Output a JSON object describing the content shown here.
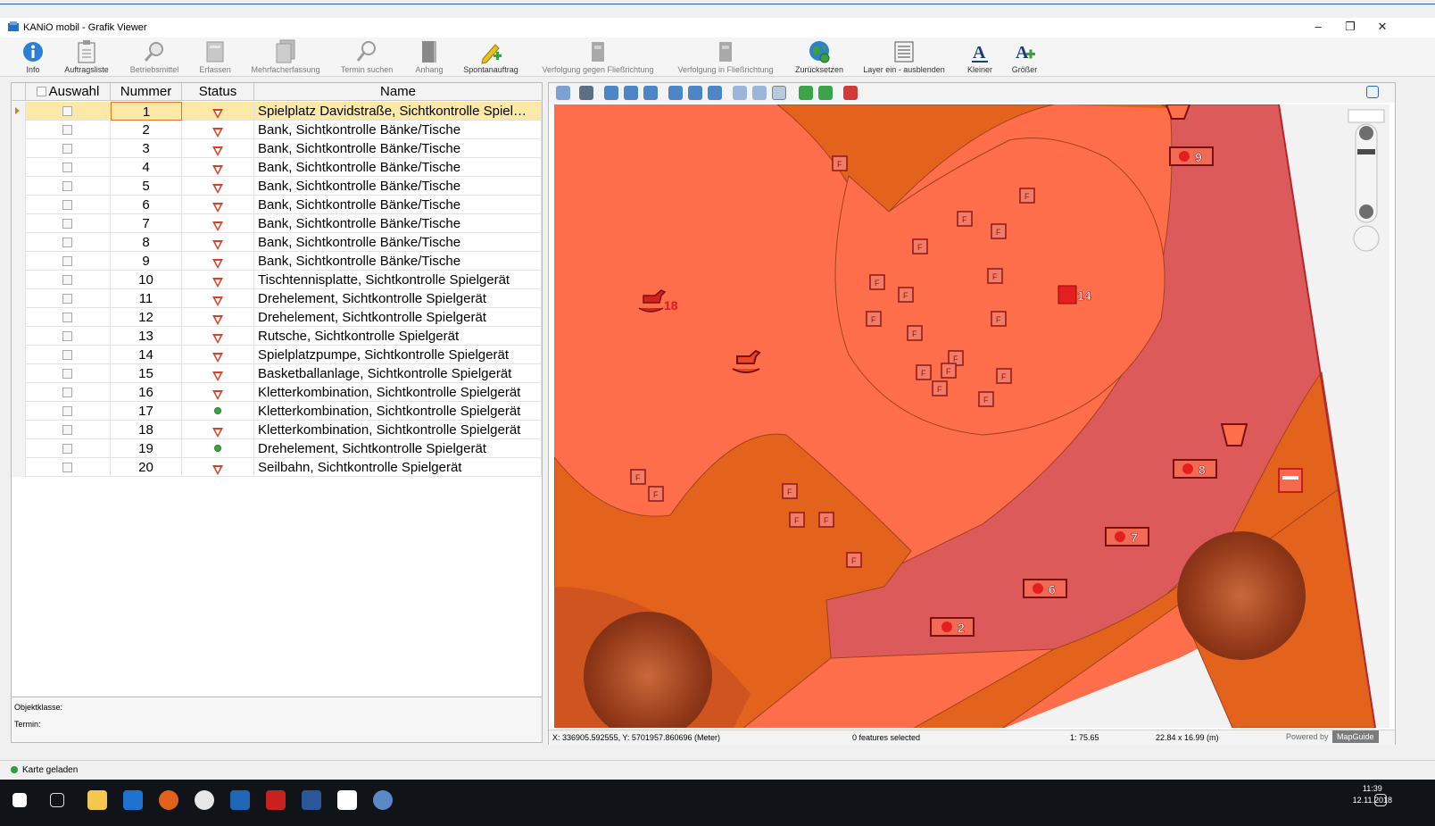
{
  "window": {
    "title": "KANiO mobil - Grafik Viewer",
    "minimize": "–",
    "restore": "❐",
    "close": "✕"
  },
  "toolbar": [
    {
      "label": "Info",
      "icon": "info-icon",
      "enabled": true
    },
    {
      "label": "Auftragsliste",
      "icon": "clipboard-icon",
      "enabled": true
    },
    {
      "label": "Betriebsmittel",
      "icon": "magnifier-icon",
      "enabled": false
    },
    {
      "label": "Erfassen",
      "icon": "form-icon",
      "enabled": false
    },
    {
      "label": "Mehrfacherfassung",
      "icon": "multi-form-icon",
      "enabled": false
    },
    {
      "label": "Termin suchen",
      "icon": "search-icon",
      "enabled": false
    },
    {
      "label": "Anhang",
      "icon": "book-icon",
      "enabled": false
    },
    {
      "label": "Spontanauftrag",
      "icon": "pencil-plus-icon",
      "enabled": true
    },
    {
      "label": "Verfolgung gegen Fließrichtung",
      "icon": "trace-upstream-icon",
      "enabled": false
    },
    {
      "label": "Verfolgung in Fließrichtung",
      "icon": "trace-downstream-icon",
      "enabled": false
    },
    {
      "label": "Zurücksetzen",
      "icon": "globe-icon",
      "enabled": true
    },
    {
      "label": "Layer ein - ausblenden",
      "icon": "layers-icon",
      "enabled": true
    },
    {
      "label": "Kleiner",
      "icon": "font-smaller-icon",
      "enabled": true
    },
    {
      "label": "Größer",
      "icon": "font-larger-icon",
      "enabled": true
    }
  ],
  "grid": {
    "headers": {
      "select": "Auswahl",
      "number": "Nummer",
      "status": "Status",
      "name": "Name"
    },
    "rows": [
      {
        "number": "1",
        "status": "open",
        "name": "Spielplatz Davidstraße, Sichtkontrolle Spiel…"
      },
      {
        "number": "2",
        "status": "open",
        "name": "Bank, Sichtkontrolle Bänke/Tische"
      },
      {
        "number": "3",
        "status": "open",
        "name": "Bank, Sichtkontrolle Bänke/Tische"
      },
      {
        "number": "4",
        "status": "open",
        "name": "Bank, Sichtkontrolle Bänke/Tische"
      },
      {
        "number": "5",
        "status": "open",
        "name": "Bank, Sichtkontrolle Bänke/Tische"
      },
      {
        "number": "6",
        "status": "open",
        "name": "Bank, Sichtkontrolle Bänke/Tische"
      },
      {
        "number": "7",
        "status": "open",
        "name": "Bank, Sichtkontrolle Bänke/Tische"
      },
      {
        "number": "8",
        "status": "open",
        "name": "Bank, Sichtkontrolle Bänke/Tische"
      },
      {
        "number": "9",
        "status": "open",
        "name": "Bank, Sichtkontrolle Bänke/Tische"
      },
      {
        "number": "10",
        "status": "open",
        "name": "Tischtennisplatte, Sichtkontrolle Spielgerät"
      },
      {
        "number": "11",
        "status": "open",
        "name": "Drehelement, Sichtkontrolle Spielgerät"
      },
      {
        "number": "12",
        "status": "open",
        "name": "Drehelement, Sichtkontrolle Spielgerät"
      },
      {
        "number": "13",
        "status": "open",
        "name": "Rutsche, Sichtkontrolle Spielgerät"
      },
      {
        "number": "14",
        "status": "open",
        "name": "Spielplatzpumpe, Sichtkontrolle Spielgerät"
      },
      {
        "number": "15",
        "status": "open",
        "name": "Basketballanlage, Sichtkontrolle Spielgerät"
      },
      {
        "number": "16",
        "status": "open",
        "name": "Kletterkombination, Sichtkontrolle Spielgerät"
      },
      {
        "number": "17",
        "status": "done",
        "name": "Kletterkombination, Sichtkontrolle Spielgerät"
      },
      {
        "number": "18",
        "status": "open",
        "name": "Kletterkombination, Sichtkontrolle Spielgerät"
      },
      {
        "number": "19",
        "status": "done",
        "name": "Drehelement, Sichtkontrolle Spielgerät"
      },
      {
        "number": "20",
        "status": "open",
        "name": "Seilbahn, Sichtkontrolle Spielgerät"
      }
    ]
  },
  "details": {
    "objektklasse": "Objektklasse:",
    "termin": "Termin:"
  },
  "map": {
    "labels": [
      "18",
      "14",
      "9",
      "8",
      "7",
      "6",
      "2"
    ],
    "feature_letter": "F",
    "status": {
      "coords": "X: 336905.592555, Y: 5701957.860696 (Meter)",
      "selected": "0 features selected",
      "scale": "1: 75.65",
      "size": "22.84 x 16.99 (m)",
      "powered_prefix": "Powered by",
      "powered_brand": "MapGuide"
    },
    "colors": {
      "light": "#ff6e4a",
      "mid": "#e3631c",
      "rose": "#dc5a5a",
      "dark": "#d05420",
      "marker": "#d42020"
    }
  },
  "statusbar": {
    "text": "Karte geladen"
  },
  "taskbar": {
    "time": "11:39",
    "date": "12.11.2018"
  }
}
